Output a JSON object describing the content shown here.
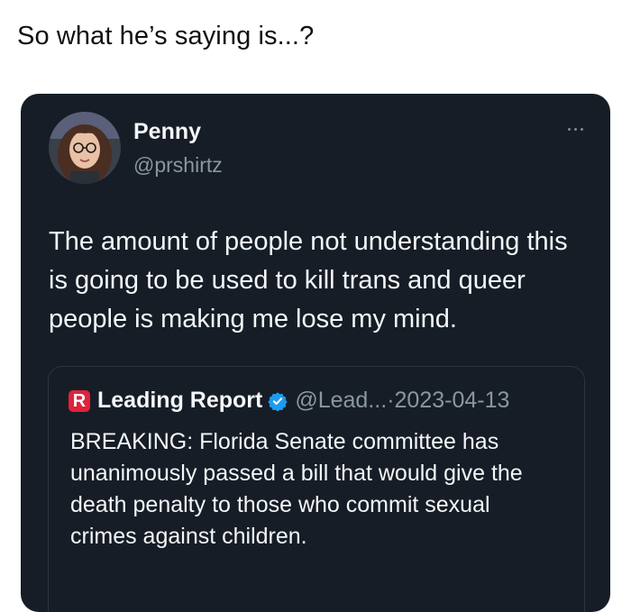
{
  "caption": "So what he’s saying is...?",
  "tweet": {
    "author": {
      "name": "Penny",
      "handle": "@prshirtz"
    },
    "text": "The amount of people not understanding this is going to be used to kill trans and queer people is making me lose my mind."
  },
  "quote": {
    "logo_letter": "R",
    "name": "Leading Report",
    "handle": "@Lead...",
    "separator": "·",
    "date": "2023-04-13",
    "text": "BREAKING: Florida Senate committee has unanimously passed a bill that would give the death penalty to those who commit sexual crimes against children."
  },
  "colors": {
    "card_background": "#161d26",
    "text_primary": "#f4f6f8",
    "text_secondary": "#8a96a3",
    "verified": "#1d9bf0",
    "logo_red": "#e0223b"
  },
  "icons": {
    "more": "more-horizontal-icon",
    "verified": "verified-badge-icon"
  }
}
